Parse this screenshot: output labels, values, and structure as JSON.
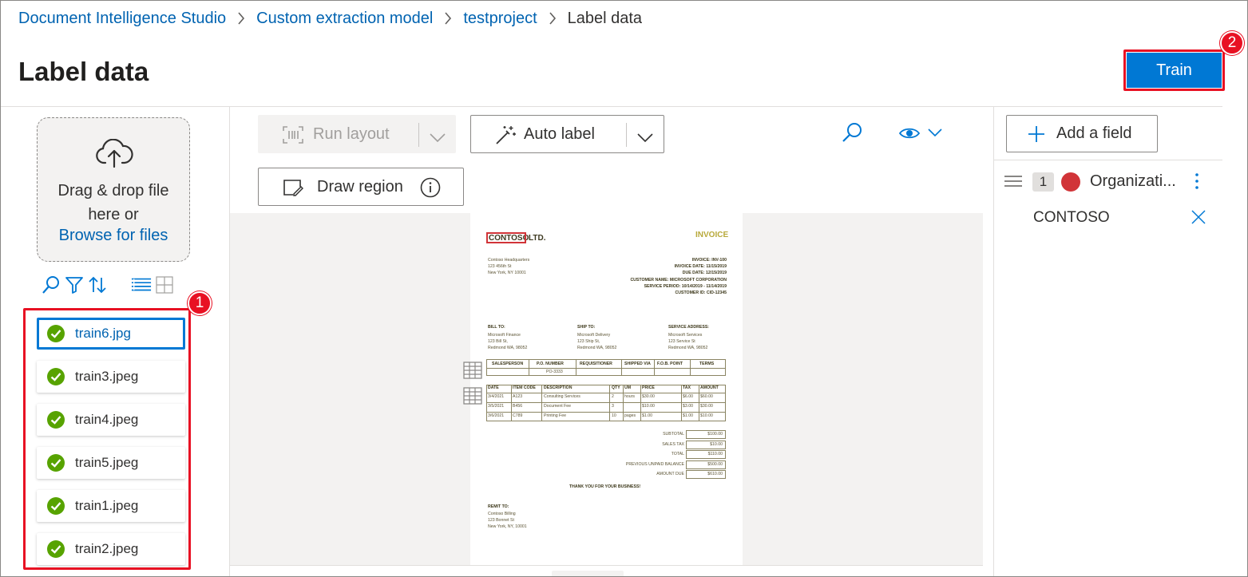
{
  "breadcrumb": {
    "items": [
      "Document Intelligence Studio",
      "Custom extraction model",
      "testproject"
    ],
    "current": "Label data"
  },
  "page": {
    "title": "Label data"
  },
  "header": {
    "train_label": "Train"
  },
  "annotations": {
    "badge_1": "1",
    "badge_2": "2",
    "accent_color": "#e81123"
  },
  "left_panel": {
    "dropzone": {
      "text": "Drag & drop file here or",
      "browse_label": "Browse for files"
    },
    "tool_icons": [
      "search-icon",
      "filter-icon",
      "sort-icon",
      "list-view-icon",
      "grid-view-icon"
    ],
    "files": [
      {
        "name": "train6.jpg",
        "status": "labeled",
        "selected": true
      },
      {
        "name": "train3.jpeg",
        "status": "labeled",
        "selected": false
      },
      {
        "name": "train4.jpeg",
        "status": "labeled",
        "selected": false
      },
      {
        "name": "train5.jpeg",
        "status": "labeled",
        "selected": false
      },
      {
        "name": "train1.jpeg",
        "status": "labeled",
        "selected": false
      },
      {
        "name": "train2.jpeg",
        "status": "labeled",
        "selected": false
      }
    ]
  },
  "toolbar": {
    "run_layout_label": "Run layout",
    "auto_label_label": "Auto label",
    "draw_region_label": "Draw region"
  },
  "document": {
    "company": "CONTOSO",
    "company_suffix": "LTD.",
    "title": "INVOICE",
    "thanks": "THANK YOU FOR YOUR BUSINESS!",
    "remit_to": "REMIT TO:",
    "remit_lines": [
      "Contoso Billing",
      "123 Bonnet St",
      "New York, NY, 10001"
    ],
    "address_lines": [
      "Contoso Headquarters",
      "123 456th St",
      "New York, NY 10001"
    ],
    "meta_lines": [
      "INVOICE: INV-100",
      "INVOICE DATE: 11/15/2019",
      "DUE DATE: 12/15/2019",
      "CUSTOMER NAME: MICROSOFT CORPORATION",
      "SERVICE PERIOD: 10/14/2019 - 11/14/2019",
      "CUSTOMER ID: CID-12345"
    ],
    "section_headers": [
      "BILL TO:",
      "SHIP TO:",
      "SERVICE ADDRESS:"
    ],
    "bill_to": [
      "Microsoft Finance",
      "123 Bill St,",
      "Redmond WA, 98052"
    ],
    "ship_to": [
      "Microsoft Delivery",
      "123 Ship St,",
      "Redmond WA, 98052"
    ],
    "service_address": [
      "Microsoft Services",
      "123 Service St",
      "Redmond WA, 98052"
    ],
    "table1_headers": [
      "SALESPERSON",
      "P.O. NUMBER",
      "REQUISITIONER",
      "SHIPPED VIA",
      "F.O.B. POINT",
      "TERMS"
    ],
    "table1_po": "PO-3333",
    "table2_headers": [
      "DATE",
      "ITEM CODE",
      "DESCRIPTION",
      "QTY",
      "UM",
      "PRICE",
      "TAX",
      "AMOUNT"
    ],
    "table2_rows": [
      [
        "3/4/2021",
        "A123",
        "Consulting Services",
        "2",
        "hours",
        "$30.00",
        "$6.00",
        "$60.00"
      ],
      [
        "3/5/2021",
        "B456",
        "Document Fee",
        "3",
        "",
        "$10.00",
        "$3.00",
        "$30.00"
      ],
      [
        "3/6/2021",
        "C789",
        "Printing Fee",
        "10",
        "pages",
        "$1.00",
        "$1.00",
        "$10.00"
      ]
    ],
    "totals": [
      [
        "SUBTOTAL",
        "$100.00"
      ],
      [
        "SALES TAX",
        "$10.00"
      ],
      [
        "TOTAL",
        "$110.00"
      ],
      [
        "PREVIOUS UNPAID BALANCE",
        "$500.00"
      ],
      [
        "AMOUNT DUE",
        "$610.00"
      ]
    ]
  },
  "right_panel": {
    "add_field_label": "Add a field",
    "fields": [
      {
        "index": "1",
        "name": "Organizati...",
        "color": "#d13438",
        "value": "CONTOSO"
      }
    ]
  }
}
